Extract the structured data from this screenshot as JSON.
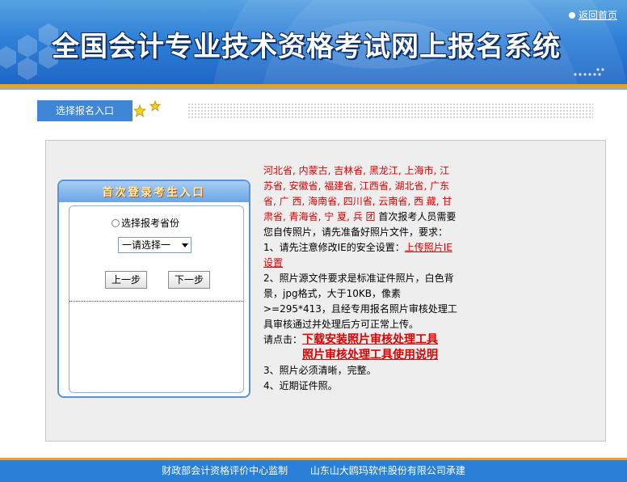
{
  "header": {
    "title": "全国会计专业技术资格考试网上报名系统",
    "home_link": "返回首页"
  },
  "tab": {
    "label": "选择报名入口"
  },
  "login": {
    "title": "首次登录考生入口",
    "province_radio_label": "选择报考省份",
    "province_select_value": "一请选择一",
    "prev_button": "上一步",
    "next_button": "下一步"
  },
  "info": {
    "provinces": "河北省, 内蒙古, 吉林省, 黑龙江, 上海市, 江苏省, 安徽省, 福建省, 江西省, 湖北省, 广东省, 广 西, 海南省, 四川省, 云南省, 西 藏, 甘肃省, 青海省, 宁 夏, 兵 团",
    "intro": " 首次报考人员需要您自传照片，请先准备好照片文件，要求：",
    "item1_prefix": "1、请先注意修改IE的安全设置：",
    "item1_link": "上传照片IE设置",
    "item2": "2、照片源文件要求是标准证件照片，白色背景，jpg格式，大于10KB，像素>=295*413，且经专用报名照片审核处理工具审核通过并处理后方可正常上传。",
    "click_prefix": "请点击：",
    "download_link": "下载安装照片审核处理工具",
    "manual_link": "照片审核处理工具使用说明",
    "item3": "3、照片必须清晰，完整。",
    "item4": "4、近期证件照。"
  },
  "footer": {
    "supervisor": "财政部会计资格评价中心监制",
    "contractor": "山东山大鸥玛软件股份有限公司承建"
  },
  "colors": {
    "banner_blue": "#2f80d8",
    "accent_orange": "#f0a020",
    "link_red": "#e00000"
  }
}
